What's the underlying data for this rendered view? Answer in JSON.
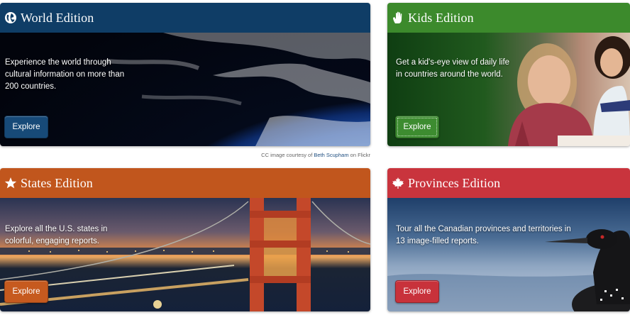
{
  "world": {
    "title": "World Edition",
    "description": "Experience the world through cultural information on more than 200 countries.",
    "button": "Explore",
    "icon": "globe-icon",
    "header_color": "#0f3d66"
  },
  "kids": {
    "title": "Kids Edition",
    "description": "Get a kid's-eye view of daily life in countries around the world.",
    "button": "Explore",
    "icon": "hand-icon",
    "header_color": "#3c8a2c"
  },
  "states": {
    "title": "States Edition",
    "description": "Explore all the U.S. states in colorful, engaging reports.",
    "button": "Explore",
    "icon": "star-icon",
    "header_color": "#c1561d"
  },
  "provinces": {
    "title": "Provinces Edition",
    "description": "Tour all the Canadian provinces and territories in 13 image-filled reports.",
    "button": "Explore",
    "icon": "maple-leaf-icon",
    "header_color": "#c9343d"
  },
  "credit": {
    "prefix": "CC image courtesy of ",
    "author": "Beth Scupham",
    "suffix": " on Flickr"
  }
}
